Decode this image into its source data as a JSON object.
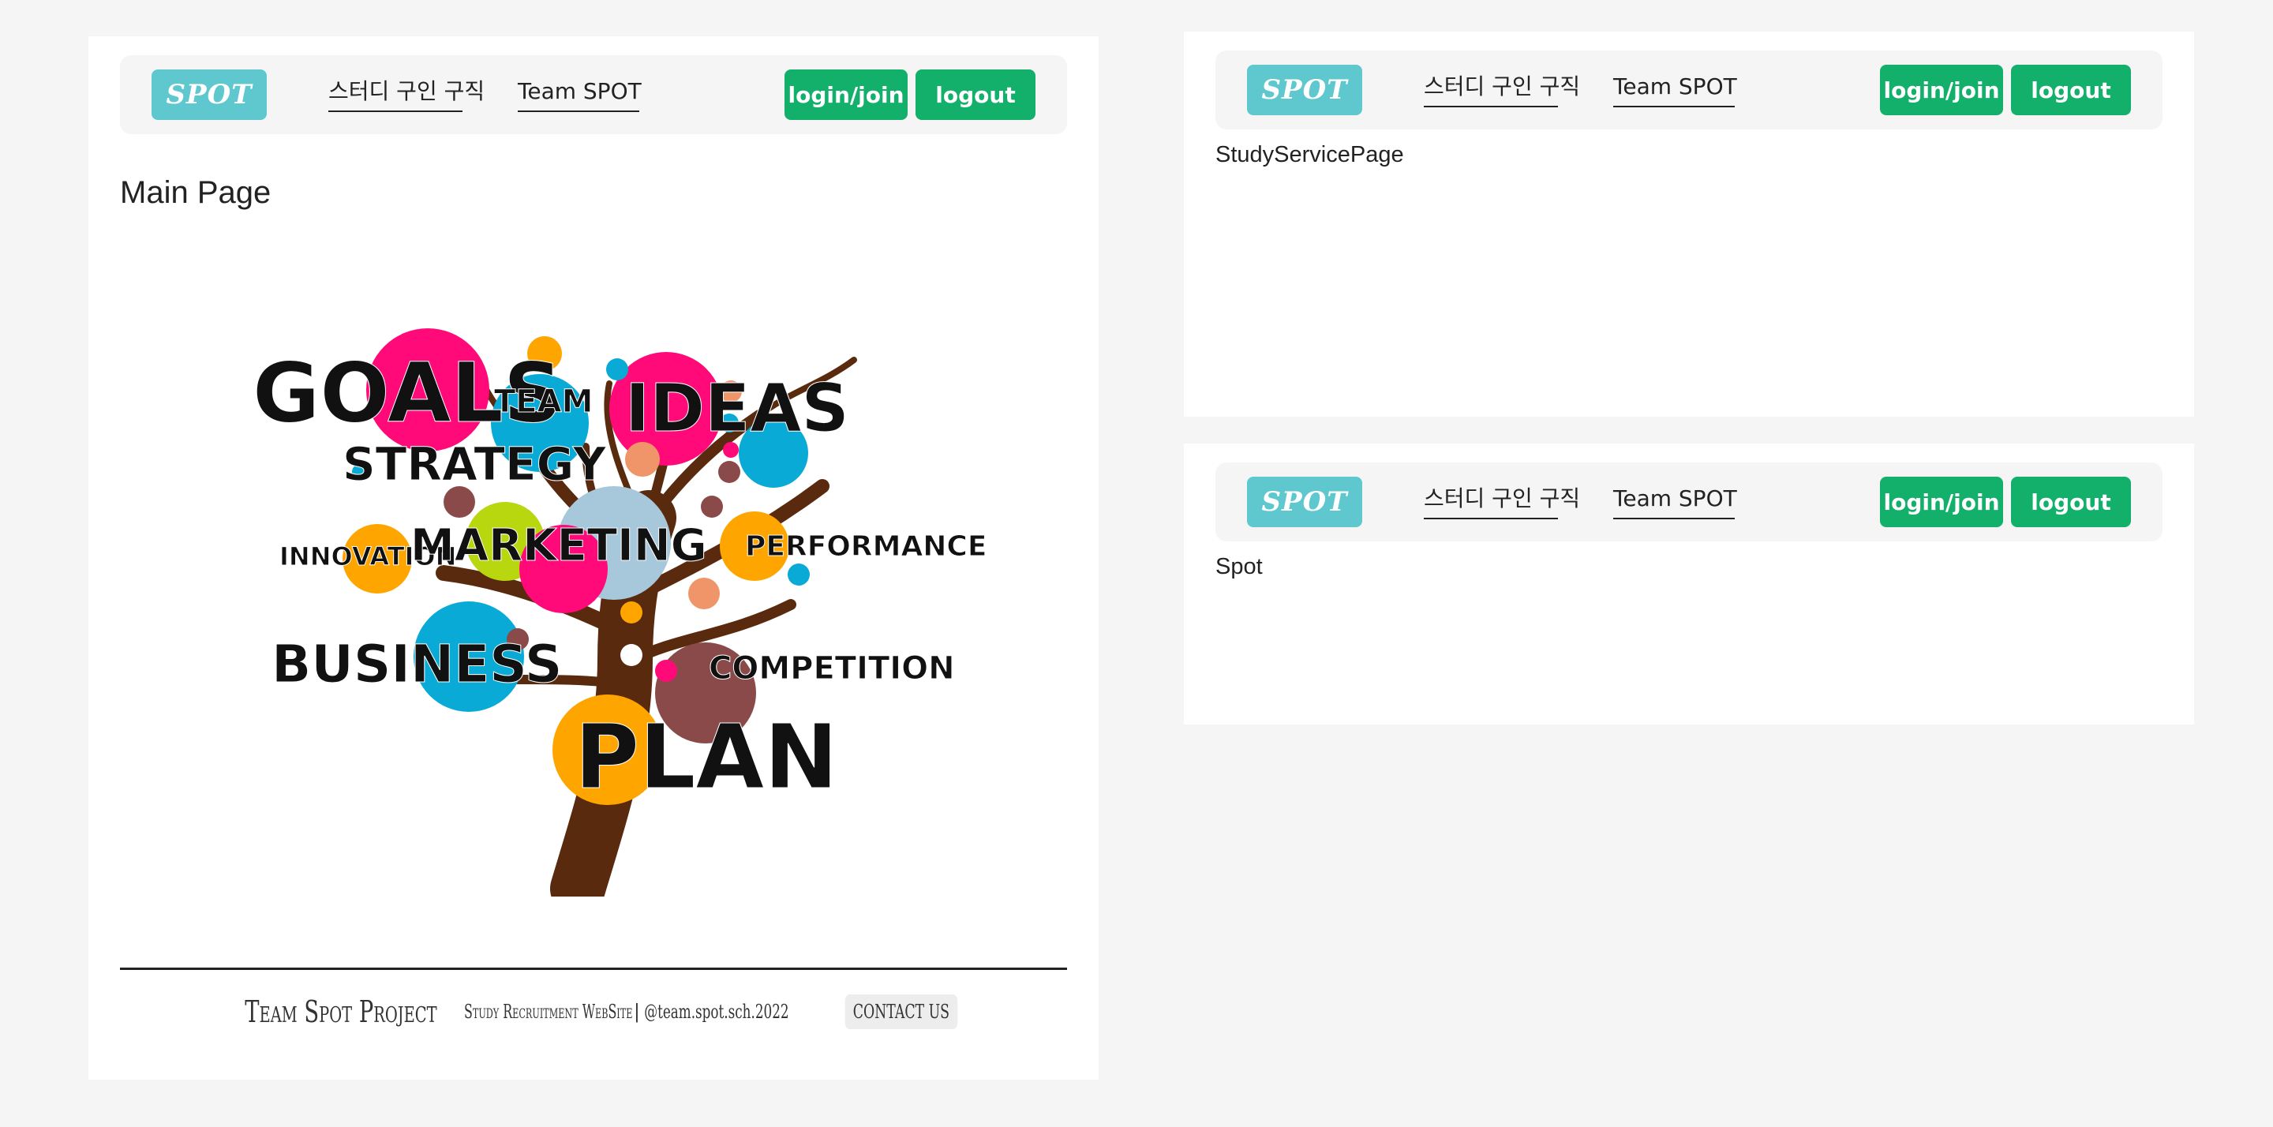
{
  "nav": {
    "brand": "SPOT",
    "link_study": "스터디 구인 구직",
    "link_team": "Team SPOT",
    "login_label": "login/join",
    "logout_label": "logout"
  },
  "main_panel": {
    "title": "Main Page",
    "hero_words": {
      "goals": "GOALS",
      "team": "TEAM",
      "ideas": "IDEAS",
      "strategy": "STRATEGY",
      "innovation": "INNOVATION",
      "marketing": "MARKETING",
      "performance": "PERFORMANCE",
      "business": "BUSINESS",
      "competition": "COMPETITION",
      "plan": "PLAN"
    },
    "footer": {
      "brand": "Team Spot Project",
      "subtitle": "Study Recruitment WebSite",
      "separator": "|",
      "handle": "@team.spot.sch.2022",
      "contact_label": "CONTACT US"
    }
  },
  "study_panel": {
    "label": "StudyServicePage"
  },
  "spot_panel": {
    "label": "Spot"
  },
  "colors": {
    "background": "#f5f5f5",
    "brand": "#5fc8cf",
    "button": "#12b06b",
    "pink": "#ff0a78",
    "cyan": "#0aaad6",
    "orange": "#ffa500",
    "trunk": "#5a2a0e"
  }
}
